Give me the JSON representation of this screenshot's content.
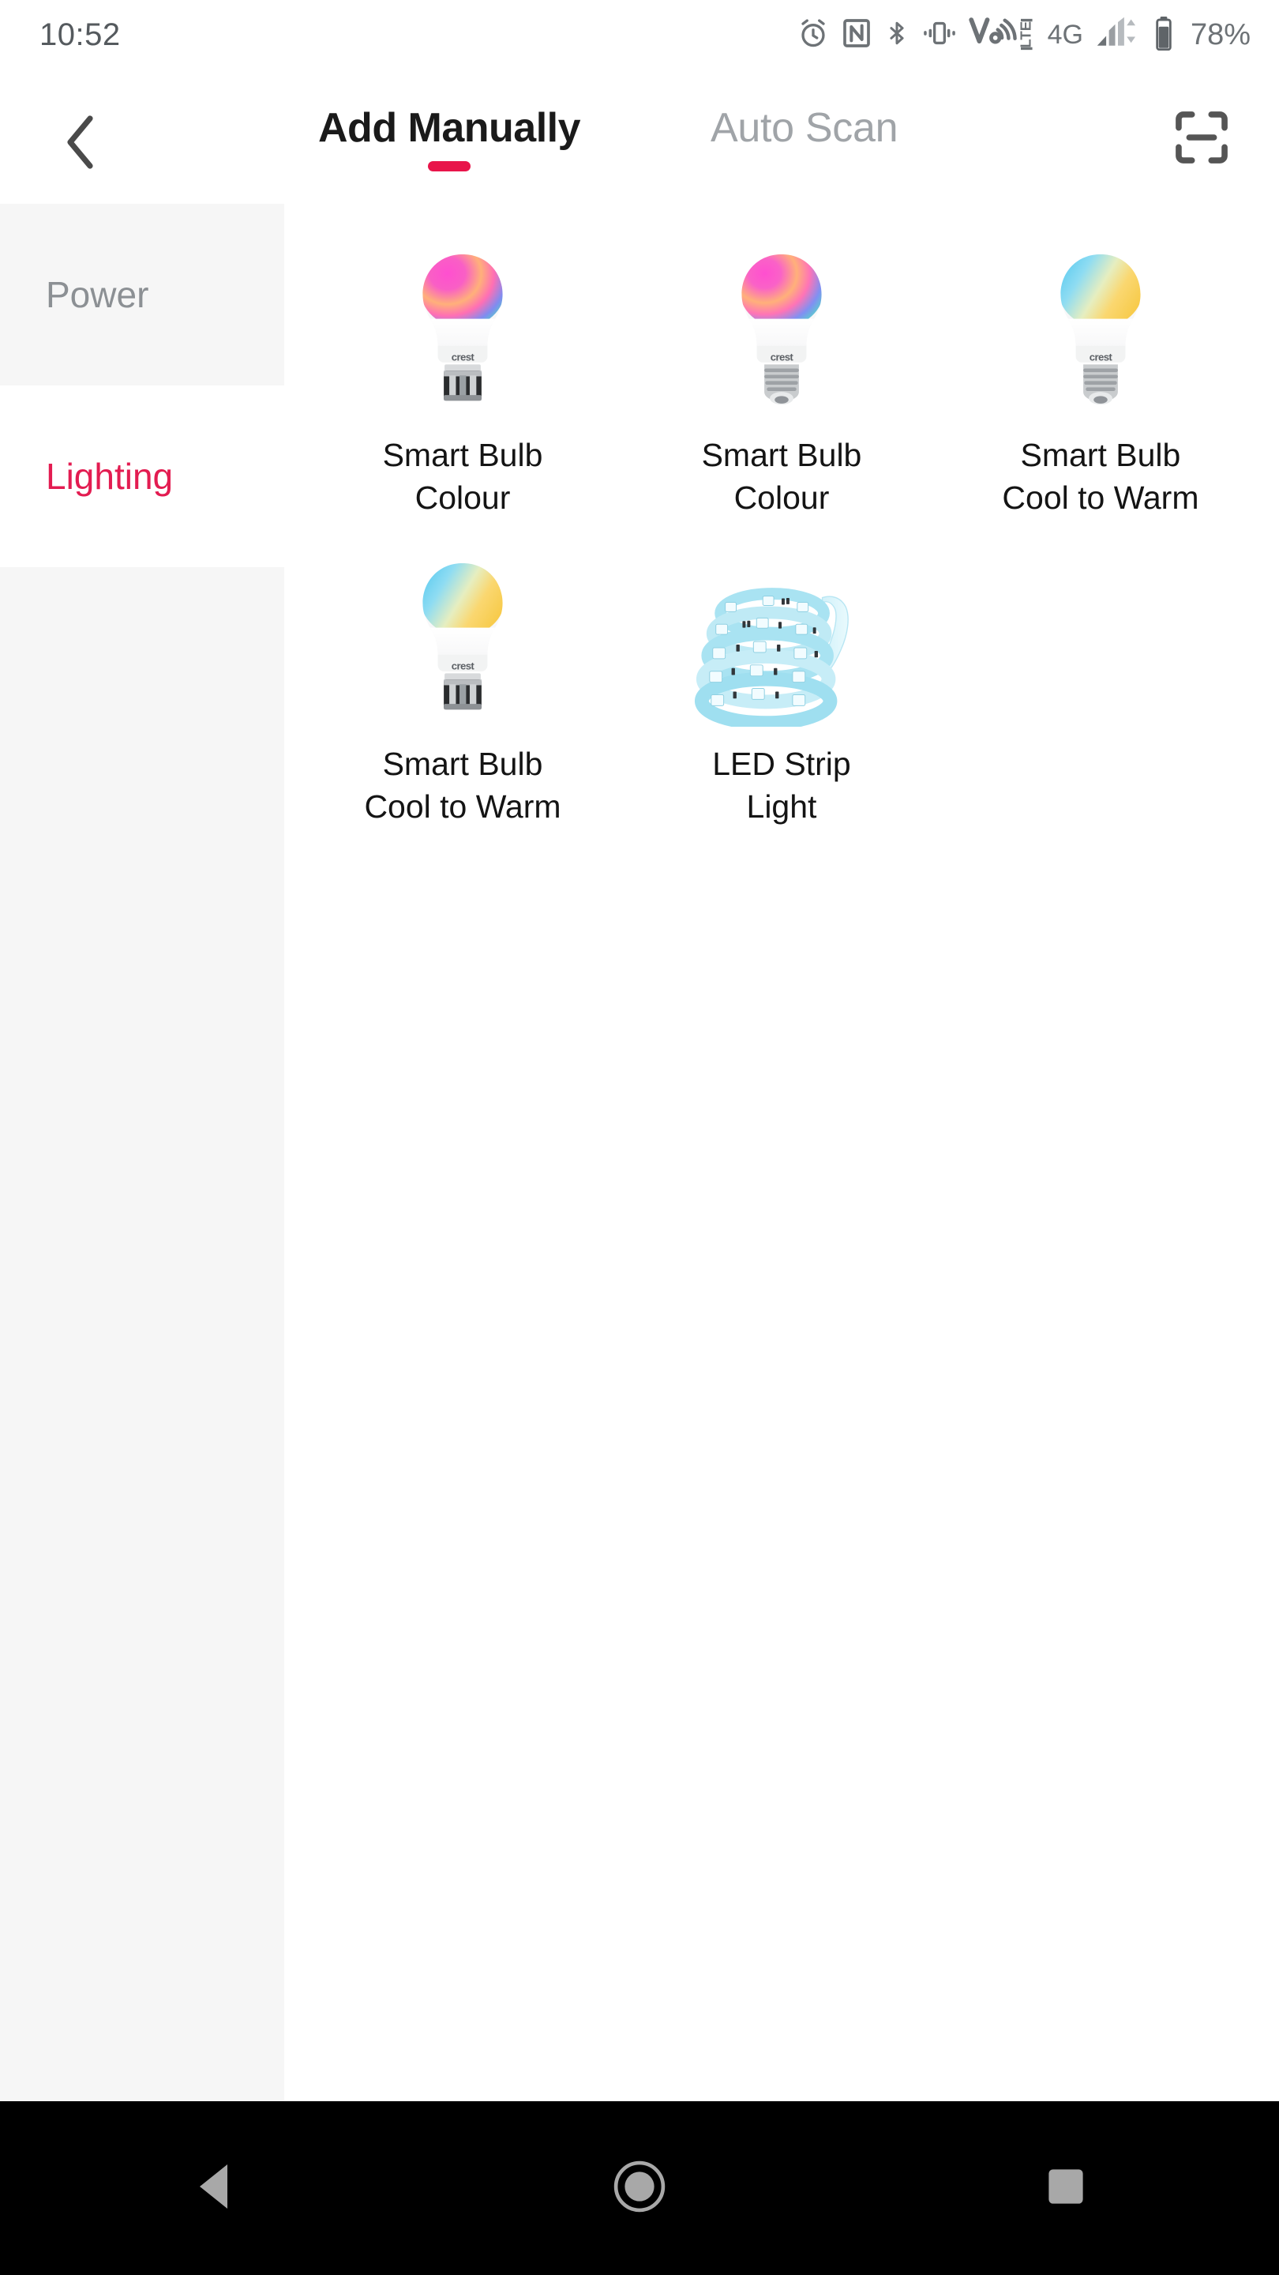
{
  "status_bar": {
    "time": "10:52",
    "battery_percent": "78%",
    "network_type": "4G",
    "icons": [
      "alarm-icon",
      "nfc-icon",
      "bluetooth-icon",
      "vibrate-icon",
      "volte-icon",
      "signal-bars-icon",
      "battery-icon"
    ]
  },
  "header": {
    "back_label": "Back",
    "tabs": [
      {
        "label": "Add Manually",
        "active": true
      },
      {
        "label": "Auto Scan",
        "active": false
      }
    ],
    "scan_label": "Scan"
  },
  "sidebar": {
    "items": [
      {
        "label": "Power",
        "active": false
      },
      {
        "label": "Lighting",
        "active": true
      }
    ]
  },
  "devices": [
    {
      "label": "Smart Bulb\nColour",
      "art": "bulb-colour-bayonet"
    },
    {
      "label": "Smart Bulb\nColour",
      "art": "bulb-colour-screw"
    },
    {
      "label": "Smart Bulb\nCool to Warm",
      "art": "bulb-cct-screw"
    },
    {
      "label": "Smart Bulb\nCool to Warm",
      "art": "bulb-cct-bayonet"
    },
    {
      "label": "LED Strip\nLight",
      "art": "led-strip"
    }
  ],
  "brand_text": "crest",
  "navbar": {
    "back_label": "Back",
    "home_label": "Home",
    "recents_label": "Recent apps"
  },
  "colors": {
    "accent": "#e31c51",
    "tab_underline": "#e8154a",
    "sidebar_bg": "#f6f6f6",
    "text_primary": "#141414",
    "text_muted": "#8c9094",
    "status_icon": "#6d7276"
  }
}
